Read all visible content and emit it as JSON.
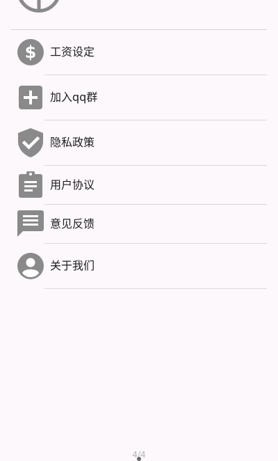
{
  "menu": {
    "items": [
      {
        "label": "工资设定",
        "icon": "dollar-icon"
      },
      {
        "label": "加入qq群",
        "icon": "add-box-icon"
      },
      {
        "label": "隐私政策",
        "icon": "shield-check-icon"
      },
      {
        "label": "用户协议",
        "icon": "clipboard-icon"
      },
      {
        "label": "意见反馈",
        "icon": "feedback-icon"
      },
      {
        "label": "关于我们",
        "icon": "account-circle-icon"
      }
    ]
  },
  "footer": {
    "page_indicator": "4/4"
  },
  "colors": {
    "icon": "#8a8a8a",
    "background": "#fdf8fc",
    "divider": "#d8d8d8"
  }
}
